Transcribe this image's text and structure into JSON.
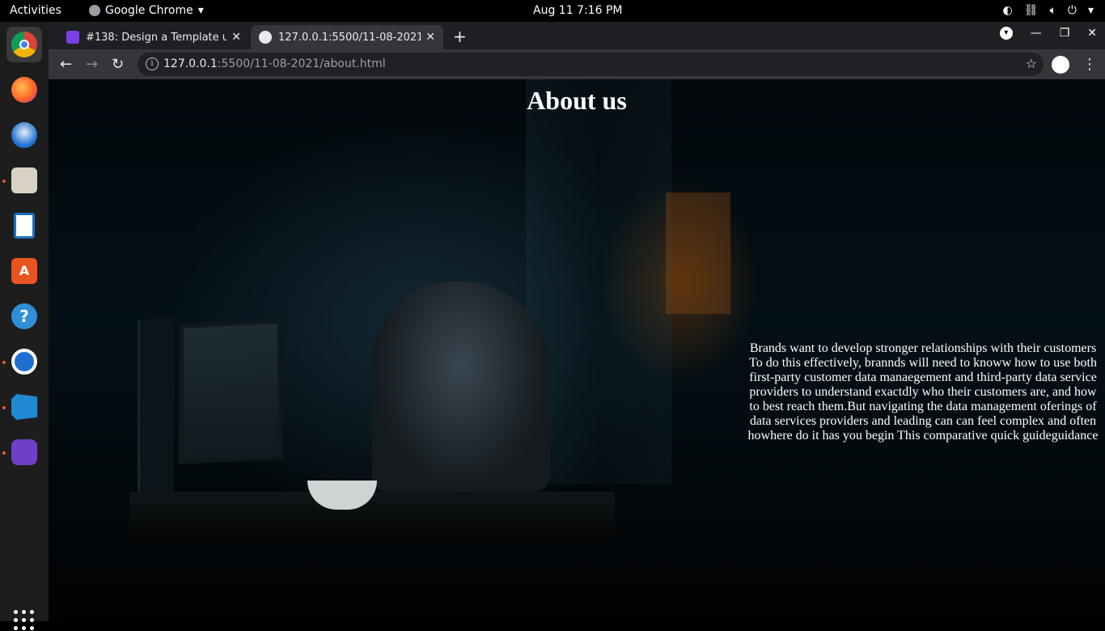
{
  "system": {
    "activities": "Activities",
    "app_name": "Google Chrome",
    "datetime": "Aug 11  7:16 PM"
  },
  "dock": {
    "items": [
      "chrome-icon",
      "firefox-icon",
      "thunderbird-icon",
      "files-icon",
      "writer-icon",
      "software-icon",
      "help-icon",
      "timer-icon",
      "vscode-icon",
      "github-icon"
    ],
    "accent": "#e95420"
  },
  "browser": {
    "tabs": [
      {
        "title": "#138: Design a Template u",
        "active": false
      },
      {
        "title": "127.0.0.1:5500/11-08-2021",
        "active": true
      }
    ],
    "url_host": "127.0.0.1",
    "url_path": ":5500/11-08-2021/about.html"
  },
  "page": {
    "heading": "About us",
    "body": "Brands want to develop stronger relationships with their customers To do this effectively, brannds will need to knoww how to use both first-party customer data manaegement and third-party data service providers to understand exactdly who their customers are, and how to best reach them.But navigating the data management oferings of data services providers and leading can can feel complex and often howhere do it has you begin This comparative quick guideguidance"
  }
}
